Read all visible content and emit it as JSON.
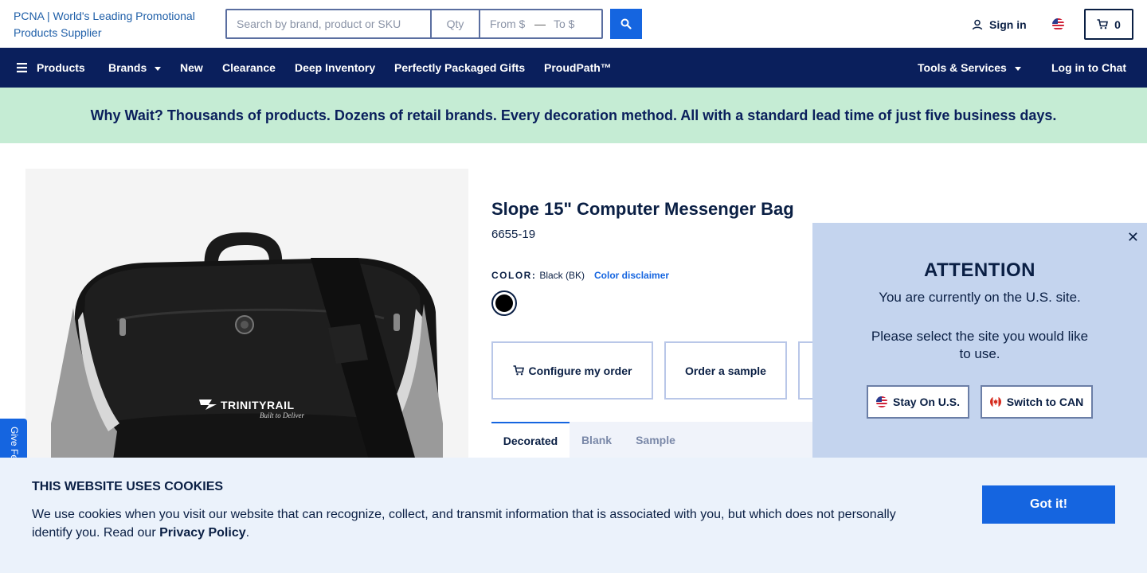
{
  "header": {
    "logo_alt": "PCNA | World's Leading Promotional Products Supplier",
    "search_placeholder": "Search by brand, product or SKU",
    "qty_placeholder": "Qty",
    "from_placeholder": "From $",
    "range_dash": "—",
    "to_placeholder": "To $",
    "signin_label": "Sign in",
    "cart_count": "0"
  },
  "nav": {
    "products": "Products",
    "brands": "Brands",
    "new": "New",
    "clearance": "Clearance",
    "deep_inventory": "Deep Inventory",
    "perfectly_packaged_gifts": "Perfectly Packaged Gifts",
    "proudpath": "ProudPath™",
    "tools_services": "Tools & Services",
    "login_chat": "Log in to Chat"
  },
  "banner": {
    "text": "Why Wait? Thousands of products. Dozens of retail brands. Every decoration method. All with a standard lead time of just five business days."
  },
  "product": {
    "title": "Slope 15\" Computer Messenger Bag",
    "sku": "6655-19",
    "color_label": "COLOR:",
    "color_value": "Black (BK)",
    "color_disclaimer": "Color disclaimer",
    "swatch_color": "#000000",
    "image_brand_text": "TRINITYRAIL",
    "image_tagline": "Built to Deliver",
    "actions": {
      "configure": "Configure my order",
      "sample": "Order a sample"
    },
    "tabs": [
      "Decorated",
      "Blank",
      "Sample"
    ]
  },
  "feedback": {
    "label": "Give Feedback"
  },
  "attention": {
    "close": "✕",
    "title": "ATTENTION",
    "message": "You are currently on the U.S. site.",
    "prompt": "Please select the site you would like to use.",
    "stay_label": "Stay On U.S.",
    "switch_label": "Switch to CAN"
  },
  "cookie": {
    "title": "THIS WEBSITE USES COOKIES",
    "text": "We use cookies when you visit our website that can recognize, collect, and transmit information that is associated with you, but which does not personally identify you. Read our ",
    "link": "Privacy Policy",
    "suffix": ".",
    "button": "Got it!"
  },
  "colors": {
    "navy": "#0a1f5c",
    "accent_blue": "#1565e0",
    "banner_green": "#c5ecd4",
    "modal_bg": "#c4d4ee",
    "cookie_bg": "#ebf2fb"
  }
}
